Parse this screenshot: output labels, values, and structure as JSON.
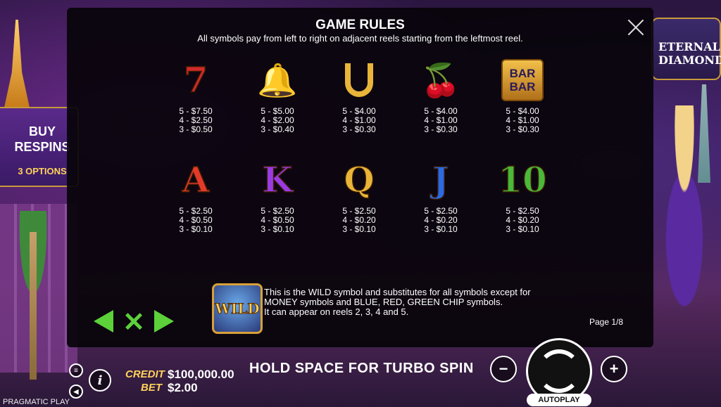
{
  "background": {
    "buy_panel": {
      "line1": "BUY",
      "line2": "RESPINS",
      "sub": "3 OPTIONS"
    },
    "logo_text": "ETERNAL DIAMONDS"
  },
  "rules": {
    "title": "GAME RULES",
    "subtitle": "All symbols pay from left to right on adjacent reels starting from the leftmost reel.",
    "row1": [
      {
        "icon": "seven-icon",
        "glyph": "7",
        "color": "#d22a2a",
        "pays": [
          "5 - $7.50",
          "4 - $2.50",
          "3 - $0.50"
        ]
      },
      {
        "icon": "bell-icon",
        "glyph": "🔔",
        "color": "#e8a21a",
        "pays": [
          "5 - $5.00",
          "4 - $2.00",
          "3 - $0.40"
        ]
      },
      {
        "icon": "horseshoe-icon",
        "glyph": "∩",
        "color": "#e8b53a",
        "pays": [
          "5 - $4.00",
          "4 - $1.00",
          "3 - $0.30"
        ]
      },
      {
        "icon": "cherry-icon",
        "glyph": "🍒",
        "color": "#d21a2a",
        "pays": [
          "5 - $4.00",
          "4 - $1.00",
          "3 - $0.30"
        ]
      },
      {
        "icon": "bar-icon",
        "glyph": "BAR",
        "color": "#e8b53a",
        "pays": [
          "5 - $4.00",
          "4 - $1.00",
          "3 - $0.30"
        ]
      }
    ],
    "row2": [
      {
        "icon": "letter-a-icon",
        "glyph": "A",
        "color": "#e23a2a",
        "pays": [
          "5 - $2.50",
          "4 - $0.50",
          "3 - $0.10"
        ]
      },
      {
        "icon": "letter-k-icon",
        "glyph": "K",
        "color": "#9a3ae2",
        "pays": [
          "5 - $2.50",
          "4 - $0.50",
          "3 - $0.10"
        ]
      },
      {
        "icon": "letter-q-icon",
        "glyph": "Q",
        "color": "#e8b53a",
        "pays": [
          "5 - $2.50",
          "4 - $0.20",
          "3 - $0.10"
        ]
      },
      {
        "icon": "letter-j-icon",
        "glyph": "J",
        "color": "#2a6ae2",
        "pays": [
          "5 - $2.50",
          "4 - $0.20",
          "3 - $0.10"
        ]
      },
      {
        "icon": "ten-icon",
        "glyph": "10",
        "color": "#4ab83a",
        "pays": [
          "5 - $2.50",
          "4 - $0.20",
          "3 - $0.10"
        ]
      }
    ],
    "wild_label": "WILD",
    "wild_text_1": "This is the WILD symbol and substitutes for all symbols except for",
    "wild_text_2": "MONEY symbols and BLUE, RED, GREEN CHIP symbols.",
    "wild_text_3": "It can appear on reels 2, 3, 4 and 5.",
    "page": "Page 1/8"
  },
  "bottom": {
    "credit_label": "CREDIT",
    "credit_value": "$100,000.00",
    "bet_label": "BET",
    "bet_value": "$2.00",
    "turbo_hint": "HOLD SPACE FOR TURBO SPIN",
    "autoplay": "AUTOPLAY",
    "minus": "−",
    "plus": "+",
    "info": "i",
    "brand": "PRAGMATIC PLAY"
  },
  "colors": {
    "nav_green": "#5cd13a",
    "gold": "#ffd35a"
  }
}
